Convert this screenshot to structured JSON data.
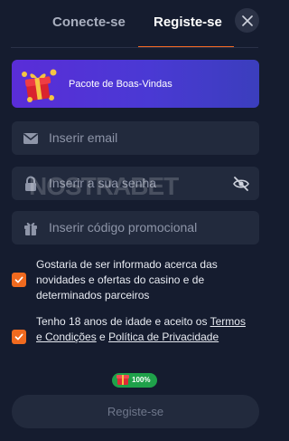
{
  "tabs": {
    "login_label": "Conecte-se",
    "register_label": "Registe-se",
    "active": "register"
  },
  "banner": {
    "label": "Pacote de Boas-Vindas",
    "icon": "gift-box-icon"
  },
  "form": {
    "email_placeholder": "Inserir email",
    "password_placeholder": "Inserir a sua senha",
    "promo_placeholder": "Inserir código promocional"
  },
  "consents": {
    "marketing_text": "Gostaria de ser informado acerca das novidades e ofertas do casino e de determinados parceiros",
    "marketing_checked": true,
    "age_text_prefix": "Tenho 18 anos de idade e aceito os ",
    "terms_link": "Termos e Condições",
    "age_text_middle": " e ",
    "privacy_link": "Política de Privacidade",
    "age_checked": true
  },
  "progress_badge": {
    "label": "100%",
    "value": 1.0
  },
  "submit_label": "Registe-se",
  "watermark": "NOSTRABET",
  "colors": {
    "background": "#151c2f",
    "field": "#222a3d",
    "accent": "#f56a24",
    "badge": "#1fa14a",
    "banner_gradient_start": "#5a2dd8",
    "banner_gradient_end": "#3b3ebd"
  }
}
